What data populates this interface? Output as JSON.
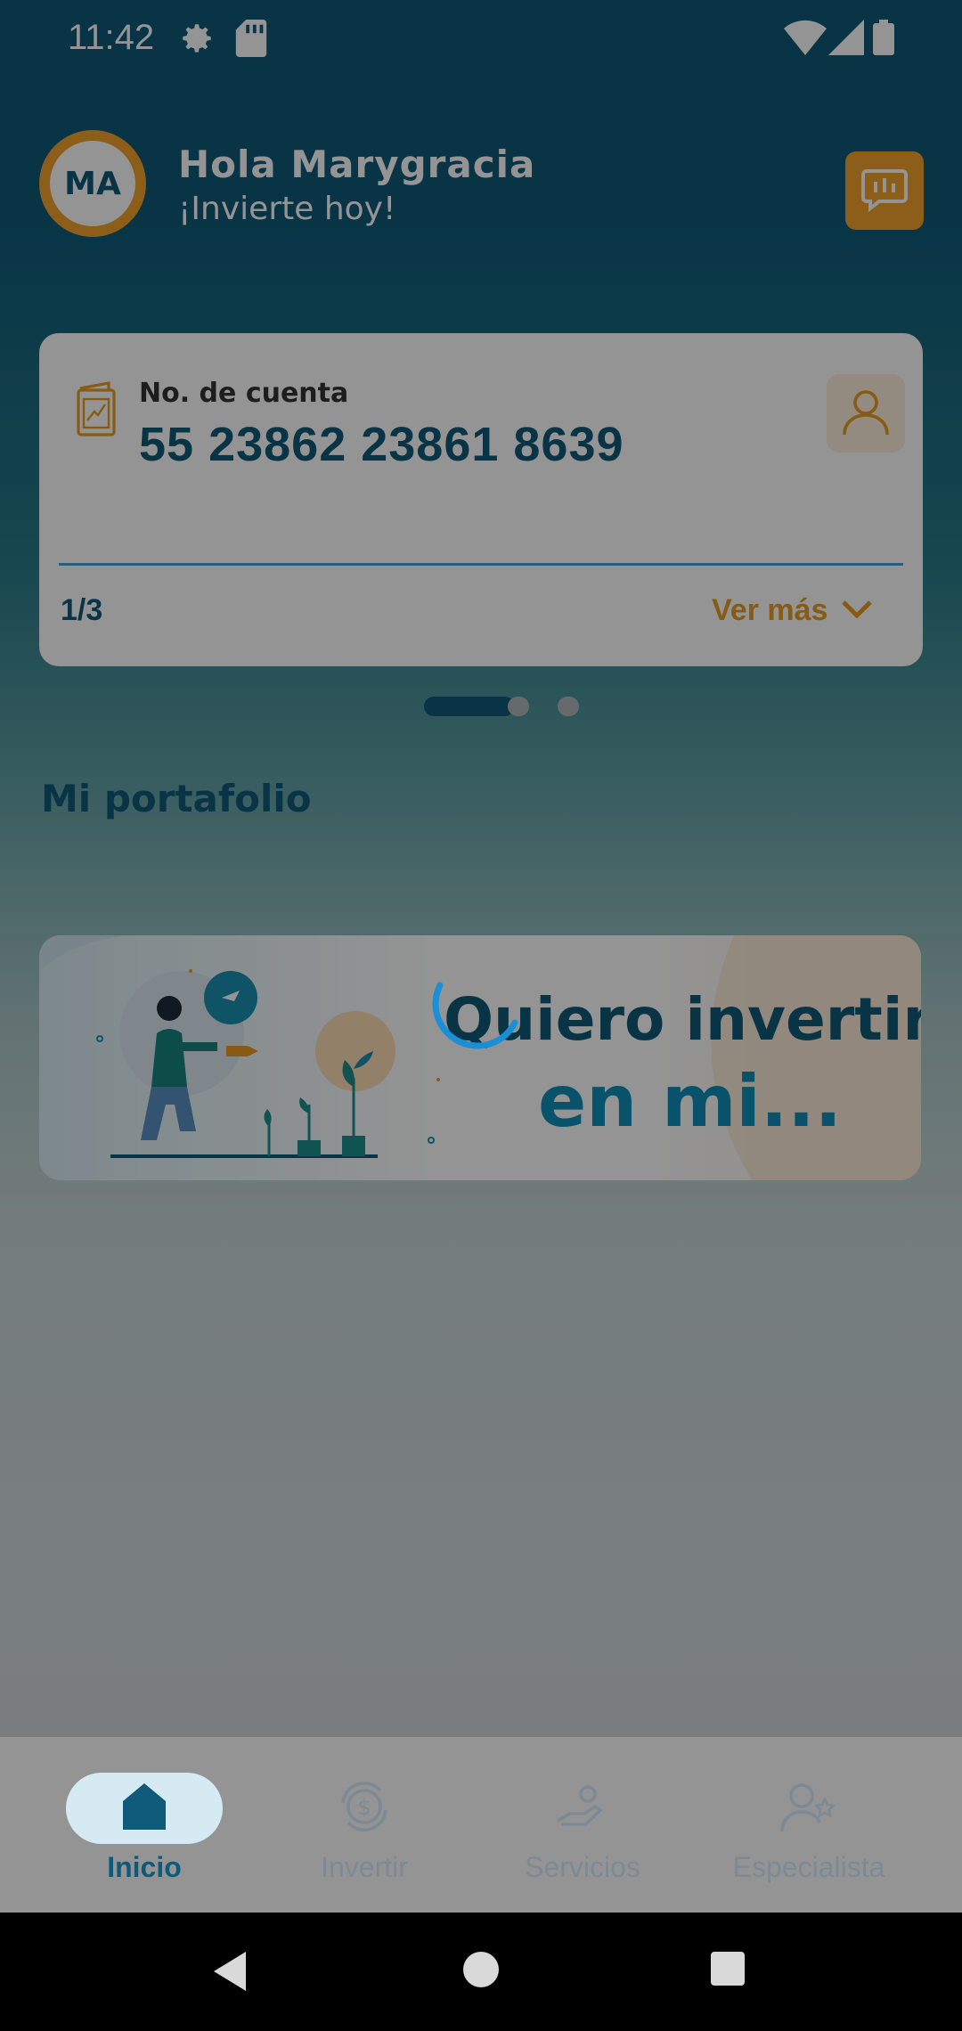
{
  "status_bar": {
    "time": "11:42",
    "icons": [
      "gear-icon",
      "sd-card-icon",
      "wifi-icon",
      "signal-icon",
      "battery-icon"
    ]
  },
  "header": {
    "avatar_initials": "MA",
    "greeting": "Hola Marygracia",
    "subtitle": "¡Invierte hoy!",
    "chat_icon": "feedback-chat-icon"
  },
  "account_card": {
    "label": "No. de cuenta",
    "number": "55 23862 23861 8639",
    "page_indicator": "1/3",
    "more_label": "Ver más",
    "icons": [
      "account-book-icon",
      "user-icon",
      "chevron-down-icon"
    ]
  },
  "carousel": {
    "count": 3,
    "active_index": 0
  },
  "portfolio": {
    "title": "Mi portafolio"
  },
  "banner": {
    "line1": "Quiero invertir",
    "line2": "en mi..."
  },
  "loading": true,
  "bottom_nav": {
    "items": [
      {
        "label": "Inicio",
        "icon": "home-icon",
        "active": true
      },
      {
        "label": "Invertir",
        "icon": "invest-icon",
        "active": false
      },
      {
        "label": "Servicios",
        "icon": "services-icon",
        "active": false
      },
      {
        "label": "Especialista",
        "icon": "specialist-icon",
        "active": false
      }
    ]
  },
  "colors": {
    "primary": "#0f5a79",
    "accent": "#f3a22c",
    "highlight": "#0f90b8",
    "overlay": "rgba(0,0,0,0.42)"
  }
}
